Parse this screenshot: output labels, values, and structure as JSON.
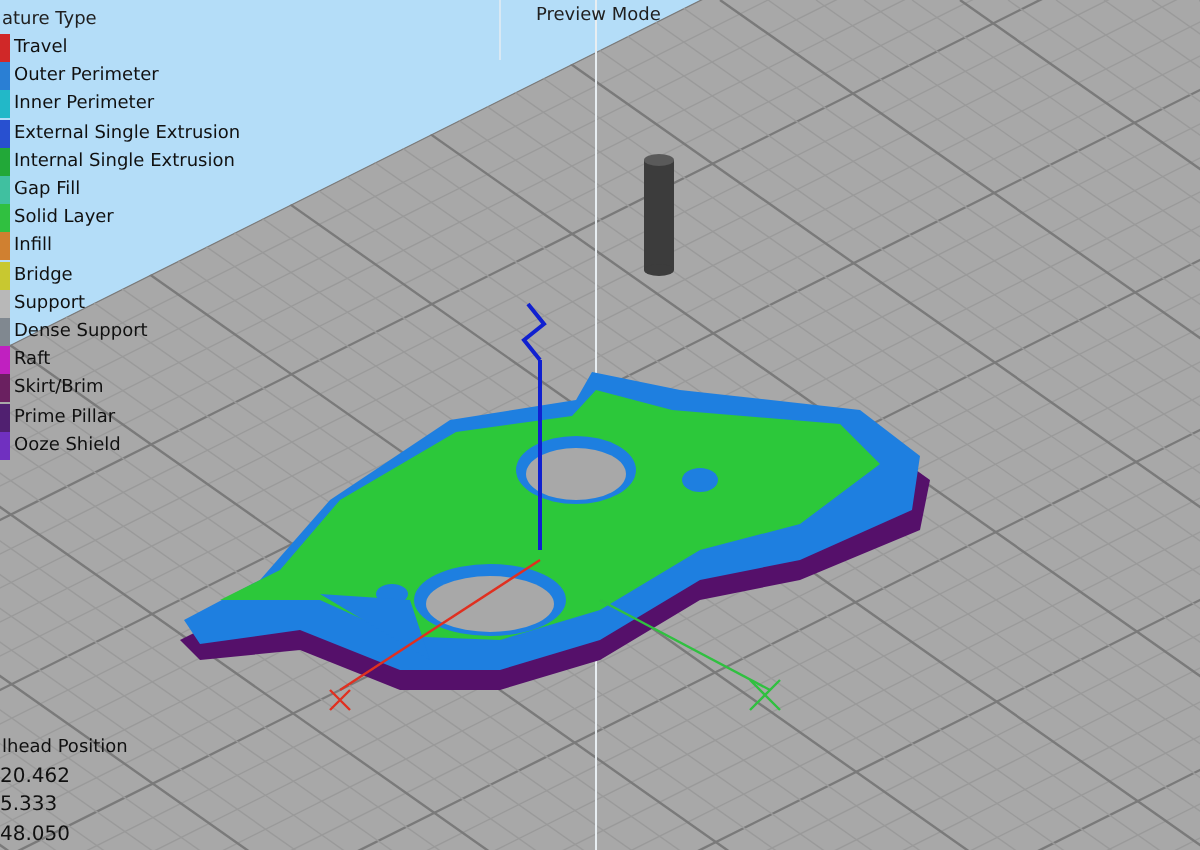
{
  "legend": {
    "title": "ature Type",
    "items": [
      {
        "label": "Travel",
        "color": "#d02828"
      },
      {
        "label": "Outer Perimeter",
        "color": "#2a7fd4"
      },
      {
        "label": "Inner Perimeter",
        "color": "#22b8c8"
      },
      {
        "label": "External Single Extrusion",
        "color": "#2850d0"
      },
      {
        "label": "Internal Single Extrusion",
        "color": "#22a838"
      },
      {
        "label": "Gap Fill",
        "color": "#40c0a0"
      },
      {
        "label": "Solid Layer",
        "color": "#30c040"
      },
      {
        "label": "Infill",
        "color": "#d08030"
      },
      {
        "label": "Bridge",
        "color": "#c8c830"
      },
      {
        "label": "Support",
        "color": "#b8b8b8"
      },
      {
        "label": "Dense Support",
        "color": "#808890"
      },
      {
        "label": "Raft",
        "color": "#c020c0"
      },
      {
        "label": "Skirt/Brim",
        "color": "#6a2060"
      },
      {
        "label": "Prime Pillar",
        "color": "#502070"
      },
      {
        "label": "Ooze Shield",
        "color": "#7030c0"
      }
    ]
  },
  "mode_label": "Preview Mode",
  "toolhead": {
    "title": "lhead Position",
    "values": [
      "20.462",
      "5.333",
      "48.050"
    ]
  }
}
